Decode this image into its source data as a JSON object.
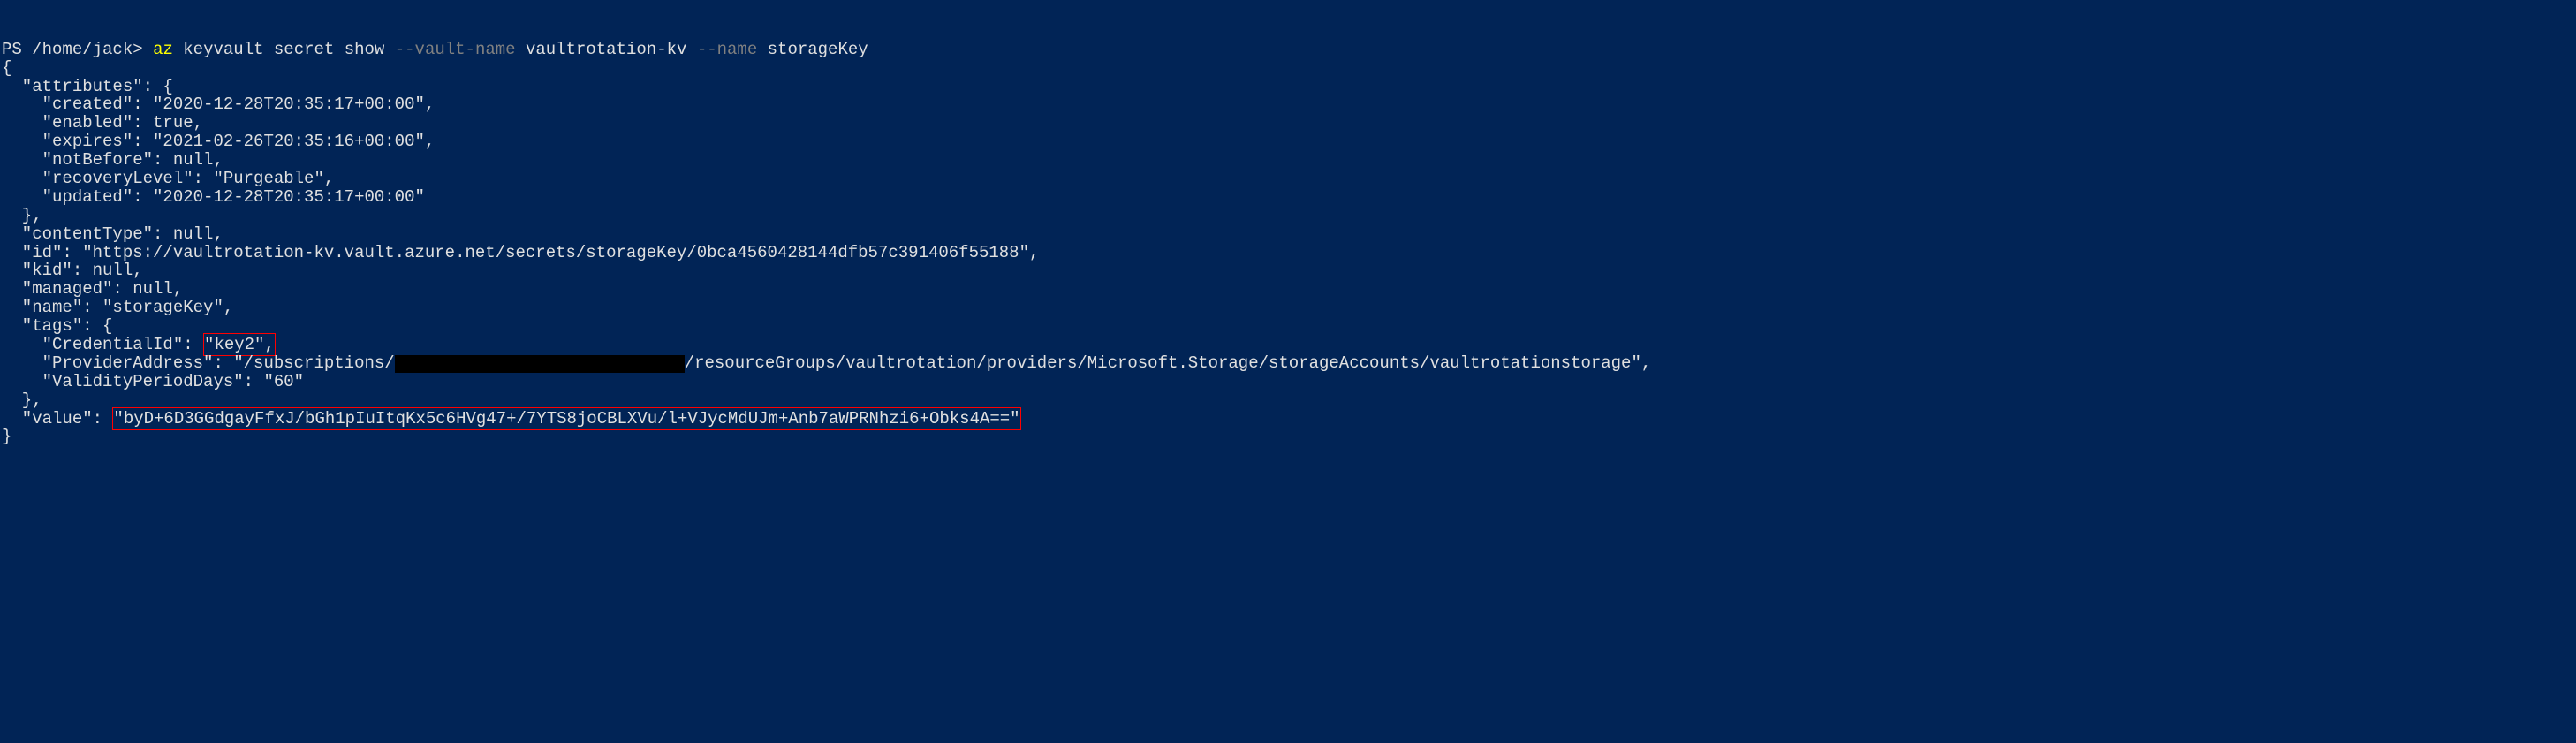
{
  "prompt": {
    "ps": "PS",
    "path": "/home/jack",
    "caret": ">",
    "command": "az",
    "args": "keyvault secret show",
    "flag1": "--vault-name",
    "val1": "vaultrotation-kv",
    "flag2": "--name",
    "val2": "storageKey"
  },
  "output": {
    "line1": "{",
    "line2": "  \"attributes\": {",
    "line3": "    \"created\": \"2020-12-28T20:35:17+00:00\",",
    "line4": "    \"enabled\": true,",
    "line5": "    \"expires\": \"2021-02-26T20:35:16+00:00\",",
    "line6": "    \"notBefore\": null,",
    "line7": "    \"recoveryLevel\": \"Purgeable\",",
    "line8": "    \"updated\": \"2020-12-28T20:35:17+00:00\"",
    "line9": "  },",
    "line10": "  \"contentType\": null,",
    "line11": "  \"id\": \"https://vaultrotation-kv.vault.azure.net/secrets/storageKey/0bca4560428144dfb57c391406f55188\",",
    "line12": "  \"kid\": null,",
    "line13": "  \"managed\": null,",
    "line14": "  \"name\": \"storageKey\",",
    "line15": "  \"tags\": {",
    "line16_pre": "    \"CredentialId\": ",
    "line16_box": "\"key2\",",
    "line17_pre": "    \"ProviderAddress\": \"/subscriptions/",
    "line17_post": "/resourceGroups/vaultrotation/providers/Microsoft.Storage/storageAccounts/vaultrotationstorage\",",
    "line18": "    \"ValidityPeriodDays\": \"60\"",
    "line19": "  },",
    "line20_pre": "  \"value\": ",
    "line20_box": "\"byD+6D3GGdgayFfxJ/bGh1pIuItqKx5c6HVg47+/7YTS8joCBLXVu/l+VJycMdUJm+Anb7aWPRNhzi6+Obks4A==\"",
    "line21": "}"
  }
}
